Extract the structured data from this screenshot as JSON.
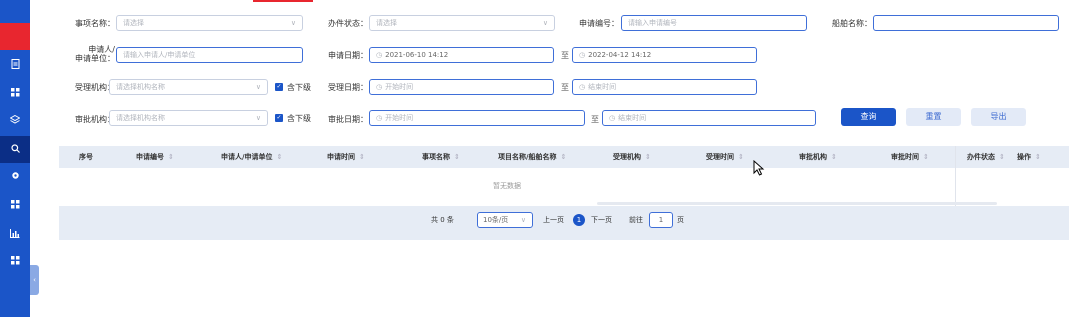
{
  "sidebar": {
    "icons": [
      "document-icon",
      "grid-icon",
      "layers-icon",
      "search-icon",
      "settings-icon",
      "grid-icon",
      "chart-icon",
      "grid-icon"
    ],
    "collapse": "‹"
  },
  "filters": {
    "item_name": {
      "label": "事项名称：",
      "placeholder": "请选择"
    },
    "status": {
      "label": "办件状态：",
      "placeholder": "请选择"
    },
    "apply_no": {
      "label": "申请编号：",
      "placeholder": "请输入申请编号"
    },
    "ship_name": {
      "label": "船舶名称：",
      "placeholder": ""
    },
    "applicant": {
      "label_line1": "申请人/",
      "label_line2": "申请单位：",
      "placeholder": "请输入申请人/申请单位"
    },
    "apply_date": {
      "label": "申请日期：",
      "start": "2021-06-10 14:12",
      "end": "2022-04-12 14:12"
    },
    "accept_org": {
      "label": "受理机构：",
      "placeholder": "请选择机构名称",
      "include_sub": "含下级"
    },
    "accept_date": {
      "label": "受理日期：",
      "start_placeholder": "开始时间",
      "end_placeholder": "结束时间"
    },
    "approve_org": {
      "label": "审批机构：",
      "placeholder": "请选择机构名称",
      "include_sub": "含下级"
    },
    "approve_date": {
      "label": "审批日期：",
      "start_placeholder": "开始时间",
      "end_placeholder": "结束时间"
    },
    "range_sep": "至"
  },
  "buttons": {
    "query": "查询",
    "reset": "重置",
    "export": "导出"
  },
  "table": {
    "columns": [
      "序号",
      "申请编号",
      "申请人/申请单位",
      "申请时间",
      "事项名称",
      "项目名称/船舶名称",
      "受理机构",
      "受理时间",
      "审批机构",
      "审批时间",
      "办件状态",
      "操作"
    ],
    "empty_text": "暂无数据"
  },
  "pagination": {
    "total": "共 0 条",
    "page_size": "10条/页",
    "prev": "上一页",
    "current": "1",
    "next": "下一页",
    "goto_prefix": "前往",
    "goto_value": "1",
    "goto_suffix": "页"
  },
  "colors": {
    "primary": "#1b55c8",
    "accent_red": "#e8262f",
    "header_bg": "#e6ecf5"
  }
}
